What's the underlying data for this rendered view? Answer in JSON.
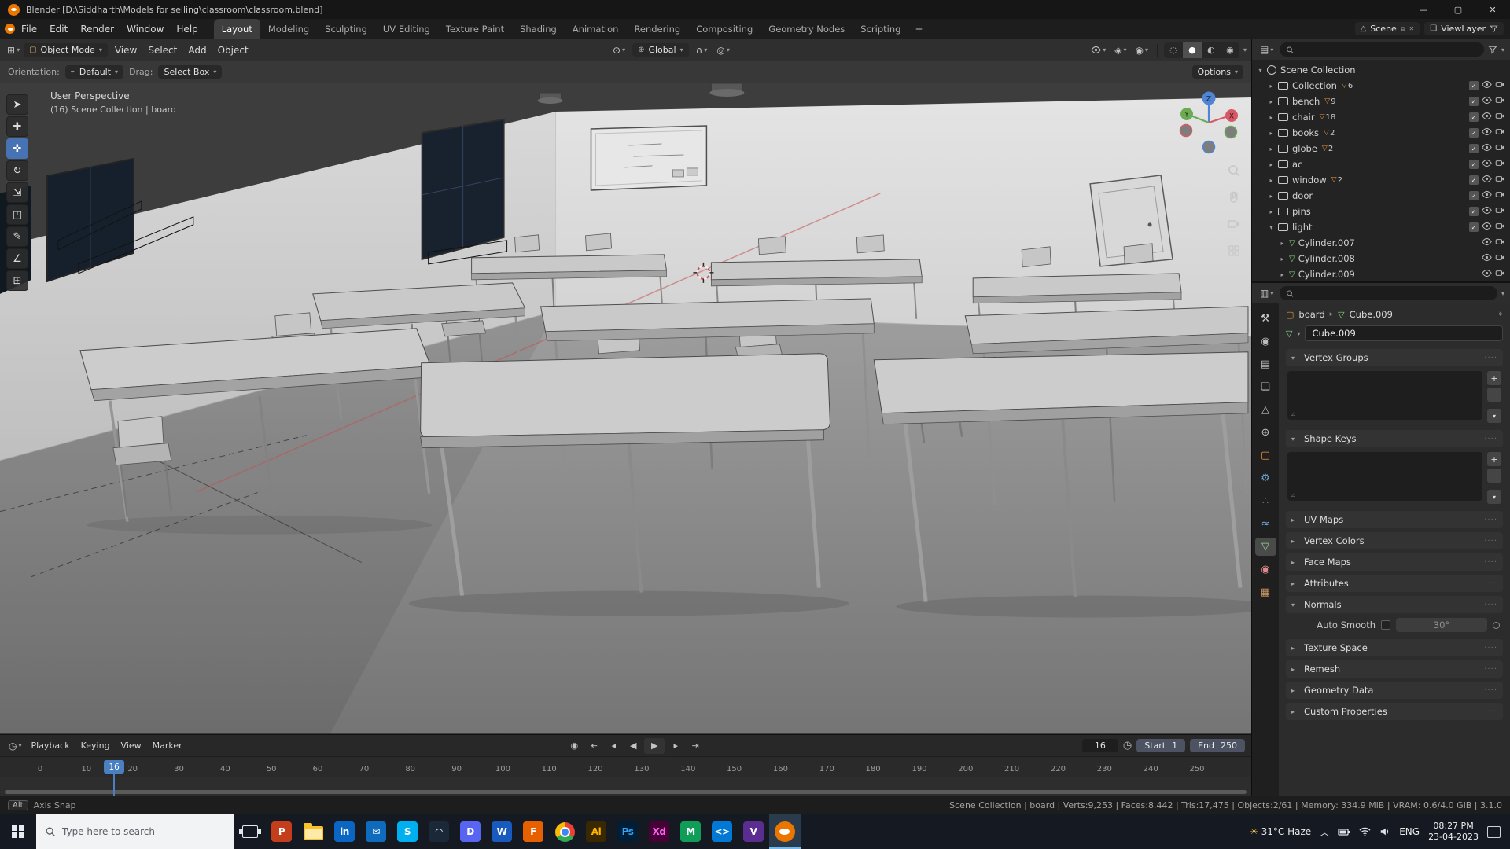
{
  "titlebar": {
    "title": "Blender [D:\\Siddharth\\Models for selling\\classroom\\classroom.blend]",
    "minimize": "—",
    "maximize": "▢",
    "close": "✕"
  },
  "topbar": {
    "menus": [
      "File",
      "Edit",
      "Render",
      "Window",
      "Help"
    ],
    "workspaces": [
      "Layout",
      "Modeling",
      "Sculpting",
      "UV Editing",
      "Texture Paint",
      "Shading",
      "Animation",
      "Rendering",
      "Compositing",
      "Geometry Nodes",
      "Scripting"
    ],
    "active_workspace": "Layout",
    "add_workspace": "+",
    "scene": {
      "label": "Scene"
    },
    "viewlayer": {
      "label": "ViewLayer"
    }
  },
  "viewport_header": {
    "mode": "Object Mode",
    "menus": [
      "View",
      "Select",
      "Add",
      "Object"
    ],
    "orientation": "Global",
    "options": "Options"
  },
  "tool_settings": {
    "orientation_label": "Orientation:",
    "orientation_value": "Default",
    "drag_label": "Drag:",
    "drag_value": "Select Box"
  },
  "viewport": {
    "overlay_line1": "User Perspective",
    "overlay_line2": "(16) Scene Collection | board",
    "axis_labels": {
      "x": "X",
      "y": "Y",
      "z": "Z"
    },
    "tools": [
      {
        "name": "tweak-select",
        "glyph": "➤",
        "active": false
      },
      {
        "name": "cursor",
        "glyph": "✚",
        "active": false
      },
      {
        "name": "move",
        "glyph": "✜",
        "active": true
      },
      {
        "name": "rotate",
        "glyph": "↻",
        "active": false
      },
      {
        "name": "scale",
        "glyph": "⇲",
        "active": false
      },
      {
        "name": "transform",
        "glyph": "◰",
        "active": false
      },
      {
        "name": "annotate",
        "glyph": "✎",
        "active": false
      },
      {
        "name": "measure",
        "glyph": "∠",
        "active": false
      },
      {
        "name": "add-cube",
        "glyph": "⊞",
        "active": false
      }
    ]
  },
  "outliner": {
    "rows": [
      {
        "label": "Scene Collection",
        "level": 0,
        "arrow": "open",
        "icon": "scene",
        "count": ""
      },
      {
        "label": "Collection",
        "level": 1,
        "arrow": "closed",
        "icon": "collection",
        "count": "6"
      },
      {
        "label": "bench",
        "level": 1,
        "arrow": "closed",
        "icon": "collection",
        "count": "9"
      },
      {
        "label": "chair",
        "level": 1,
        "arrow": "closed",
        "icon": "collection",
        "count": "18"
      },
      {
        "label": "books",
        "level": 1,
        "arrow": "closed",
        "icon": "collection",
        "count": "2"
      },
      {
        "label": "globe",
        "level": 1,
        "arrow": "closed",
        "icon": "collection",
        "count": "2"
      },
      {
        "label": "ac",
        "level": 1,
        "arrow": "closed",
        "icon": "collection",
        "count": ""
      },
      {
        "label": "window",
        "level": 1,
        "arrow": "closed",
        "icon": "collection",
        "count": "2"
      },
      {
        "label": "door",
        "level": 1,
        "arrow": "closed",
        "icon": "collection",
        "count": ""
      },
      {
        "label": "pins",
        "level": 1,
        "arrow": "closed",
        "icon": "collection",
        "count": ""
      },
      {
        "label": "light",
        "level": 1,
        "arrow": "open",
        "icon": "collection",
        "count": ""
      },
      {
        "label": "Cylinder.007",
        "level": 2,
        "arrow": "closed",
        "icon": "mesh",
        "count": ""
      },
      {
        "label": "Cylinder.008",
        "level": 2,
        "arrow": "closed",
        "icon": "mesh",
        "count": ""
      },
      {
        "label": "Cylinder.009",
        "level": 2,
        "arrow": "closed",
        "icon": "mesh",
        "count": ""
      }
    ]
  },
  "properties": {
    "breadcrumb": {
      "object": "board",
      "data": "Cube.009"
    },
    "name_value": "Cube.009",
    "tabs": [
      {
        "name": "tool",
        "glyph": "⚒",
        "color": "#c9c9c9",
        "active": false
      },
      {
        "name": "render",
        "glyph": "◉",
        "color": "#bdbdbd",
        "active": false
      },
      {
        "name": "output",
        "glyph": "▤",
        "color": "#bdbdbd",
        "active": false
      },
      {
        "name": "view-layer",
        "glyph": "❏",
        "color": "#bdbdbd",
        "active": false
      },
      {
        "name": "scene",
        "glyph": "△",
        "color": "#bdbdbd",
        "active": false
      },
      {
        "name": "world",
        "glyph": "⊕",
        "color": "#bdbdbd",
        "active": false
      },
      {
        "name": "object",
        "glyph": "▢",
        "color": "#e8913a",
        "active": false
      },
      {
        "name": "modifiers",
        "glyph": "⚙",
        "color": "#71a8d9",
        "active": false
      },
      {
        "name": "particles",
        "glyph": "∴",
        "color": "#71a8d9",
        "active": false
      },
      {
        "name": "physics",
        "glyph": "≈",
        "color": "#71a8d9",
        "active": false
      },
      {
        "name": "object-data",
        "glyph": "▽",
        "color": "#8ed88e",
        "active": true
      },
      {
        "name": "material",
        "glyph": "◉",
        "color": "#e08a8a",
        "active": false
      },
      {
        "name": "texture",
        "glyph": "▦",
        "color": "#cf9a64",
        "active": false
      }
    ],
    "sections": [
      {
        "label": "Vertex Groups",
        "state": "open",
        "kind": "listbox"
      },
      {
        "label": "Shape Keys",
        "state": "open",
        "kind": "listbox"
      },
      {
        "label": "UV Maps",
        "state": "closed",
        "kind": "plain"
      },
      {
        "label": "Vertex Colors",
        "state": "closed",
        "kind": "plain"
      },
      {
        "label": "Face Maps",
        "state": "closed",
        "kind": "plain"
      },
      {
        "label": "Attributes",
        "state": "closed",
        "kind": "plain"
      },
      {
        "label": "Normals",
        "state": "open",
        "kind": "normals"
      },
      {
        "label": "Texture Space",
        "state": "closed",
        "kind": "plain"
      },
      {
        "label": "Remesh",
        "state": "closed",
        "kind": "plain"
      },
      {
        "label": "Geometry Data",
        "state": "closed",
        "kind": "plain"
      },
      {
        "label": "Custom Properties",
        "state": "closed",
        "kind": "plain"
      }
    ],
    "normals": {
      "auto_smooth_label": "Auto Smooth",
      "angle_value": "30°"
    }
  },
  "timeline": {
    "menus": [
      "Playback",
      "Keying",
      "View",
      "Marker"
    ],
    "current_frame": "16",
    "start_label": "Start",
    "start_value": "1",
    "end_label": "End",
    "end_value": "250",
    "ticks": [
      "0",
      "10",
      "20",
      "30",
      "40",
      "50",
      "60",
      "70",
      "80",
      "90",
      "100",
      "110",
      "120",
      "130",
      "140",
      "150",
      "160",
      "170",
      "180",
      "190",
      "200",
      "210",
      "220",
      "230",
      "240",
      "250"
    ]
  },
  "statusbar": {
    "key_hint": "Alt",
    "left_text": "Axis Snap",
    "right_text": "Scene Collection | board | Verts:9,253 | Faces:8,442 | Tris:17,475 | Objects:2/61 | Memory: 334.9 MiB | VRAM: 0.6/4.0 GiB | 3.1.0"
  },
  "taskbar": {
    "search_placeholder": "Type here to search",
    "apps": [
      {
        "name": "task-view",
        "kind": "taskview"
      },
      {
        "name": "powerpoint",
        "glyph": "P",
        "bg": "#c43e1c"
      },
      {
        "name": "file-explorer",
        "kind": "folder"
      },
      {
        "name": "linkedin",
        "glyph": "in",
        "bg": "#0a66c2"
      },
      {
        "name": "mail",
        "glyph": "✉",
        "bg": "#0f6cbd"
      },
      {
        "name": "skype",
        "glyph": "S",
        "bg": "#00aff0"
      },
      {
        "name": "steam",
        "glyph": "◠",
        "bg": "#1b2838"
      },
      {
        "name": "discord",
        "glyph": "D",
        "bg": "#5865f2"
      },
      {
        "name": "word",
        "glyph": "W",
        "bg": "#185abd"
      },
      {
        "name": "firefox",
        "glyph": "F",
        "bg": "#e66000"
      },
      {
        "name": "chrome",
        "kind": "chrome"
      },
      {
        "name": "illustrator",
        "glyph": "Ai",
        "bg": "#3a2800",
        "fg": "#ffb400"
      },
      {
        "name": "photoshop",
        "glyph": "Ps",
        "bg": "#001e36",
        "fg": "#31a8ff"
      },
      {
        "name": "adobe-xd",
        "glyph": "Xd",
        "bg": "#470137",
        "fg": "#ff61f6"
      },
      {
        "name": "maya",
        "glyph": "M",
        "bg": "#0f9d58"
      },
      {
        "name": "vscode",
        "glyph": "<>",
        "bg": "#0078d4"
      },
      {
        "name": "visual-studio",
        "glyph": "V",
        "bg": "#5c2d91"
      },
      {
        "name": "blender",
        "kind": "blender",
        "active": true
      }
    ],
    "tray": {
      "weather": "31°C Haze",
      "lang": "ENG",
      "time": "08:27 PM",
      "date": "23-04-2023"
    }
  }
}
